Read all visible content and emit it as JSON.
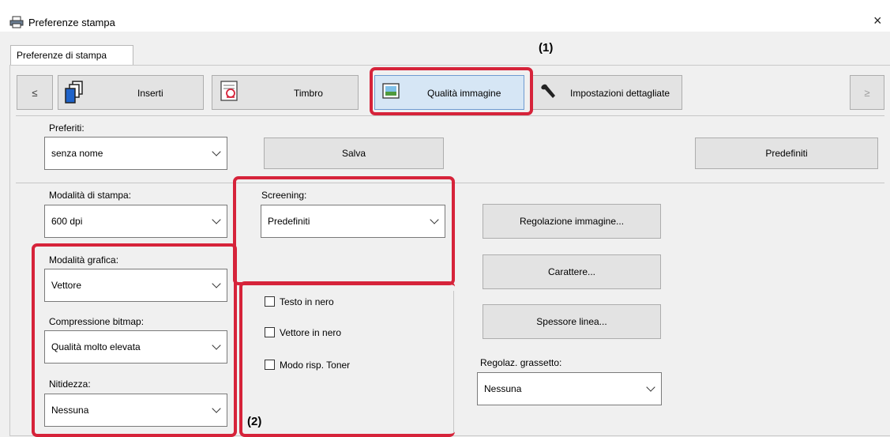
{
  "window": {
    "title": "Preferenze stampa",
    "close_glyph": "×"
  },
  "tab": {
    "label": "Preferenze di stampa"
  },
  "toolbar": {
    "prev_glyph": "≤",
    "next_glyph": "≥",
    "buttons": [
      {
        "label": "Inserti",
        "icon": "inserts-icon"
      },
      {
        "label": "Timbro",
        "icon": "stamp-icon"
      },
      {
        "label": "Qualità immagine",
        "icon": "image-quality-icon"
      },
      {
        "label": "Impostazioni dettagliate",
        "icon": "wrench-icon"
      }
    ]
  },
  "favorites": {
    "label": "Preferiti:",
    "value": "senza nome",
    "save_label": "Salva",
    "defaults_label": "Predefiniti"
  },
  "left": {
    "print_mode_label": "Modalità di stampa:",
    "print_mode_value": "600 dpi",
    "graphics_mode_label": "Modalità grafica:",
    "graphics_mode_value": "Vettore",
    "bitmap_label": "Compressione bitmap:",
    "bitmap_value": "Qualità molto elevata",
    "sharpness_label": "Nitidezza:",
    "sharpness_value": "Nessuna"
  },
  "middle": {
    "screening_label": "Screening:",
    "screening_value": "Predefiniti",
    "checkboxes": [
      {
        "label": "Testo in nero",
        "checked": false
      },
      {
        "label": "Vettore in nero",
        "checked": false
      },
      {
        "label": "Modo risp. Toner",
        "checked": false
      }
    ]
  },
  "right": {
    "image_adjust_label": "Regolazione immagine...",
    "font_label": "Carattere...",
    "line_width_label": "Spessore linea...",
    "bold_label": "Regolaz. grassetto:",
    "bold_value": "Nessuna"
  },
  "annotations": {
    "one": "(1)",
    "two": "(2)"
  },
  "colors": {
    "highlight": "#d6233a",
    "selected_button": "#d6e6f5"
  }
}
